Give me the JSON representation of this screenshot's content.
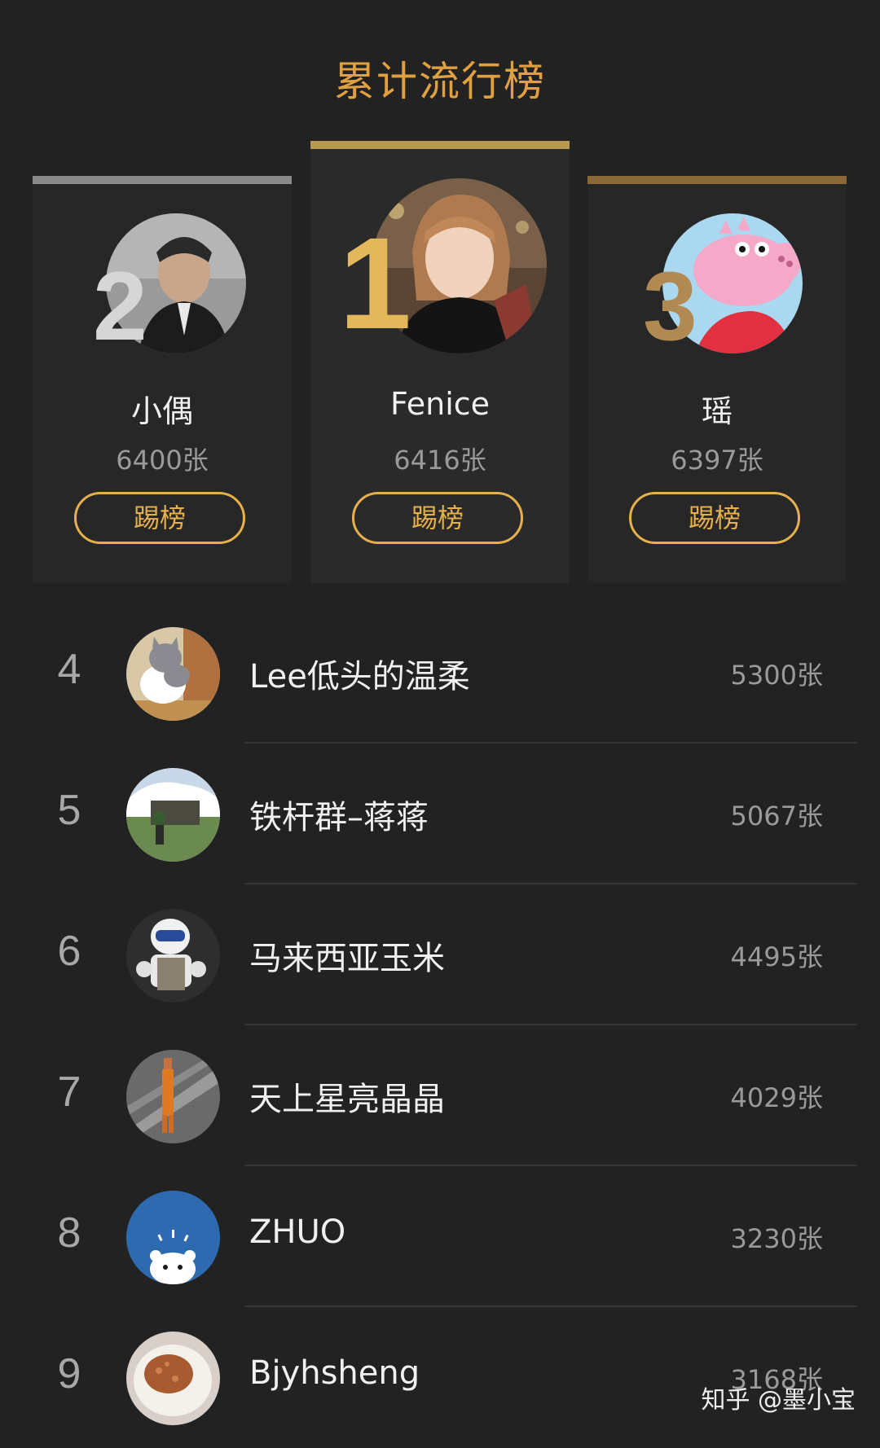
{
  "title": "累计流行榜",
  "podium": [
    {
      "rank": "2",
      "name": "小偶",
      "count": "6400张",
      "button": "踢榜"
    },
    {
      "rank": "1",
      "name": "Fenice",
      "count": "6416张",
      "button": "踢榜"
    },
    {
      "rank": "3",
      "name": "瑶",
      "count": "6397张",
      "button": "踢榜"
    }
  ],
  "list": [
    {
      "rank": "4",
      "name": "Lee低头的温柔",
      "count": "5300张"
    },
    {
      "rank": "5",
      "name": "铁杆群–蒋蒋",
      "count": "5067张"
    },
    {
      "rank": "6",
      "name": "马来西亚玉米",
      "count": "4495张"
    },
    {
      "rank": "7",
      "name": "天上星亮晶晶",
      "count": "4029张"
    },
    {
      "rank": "8",
      "name": "ZHUO",
      "count": "3230张"
    },
    {
      "rank": "9",
      "name": "Bjyhsheng",
      "count": "3168张"
    }
  ],
  "watermark": "知乎 @墨小宝",
  "colors": {
    "accent": "#e6b04c",
    "background": "#222222",
    "gold_bar": "#b89a4e",
    "silver_bar": "#8a8a8a",
    "bronze_bar": "#8a6a3a"
  }
}
